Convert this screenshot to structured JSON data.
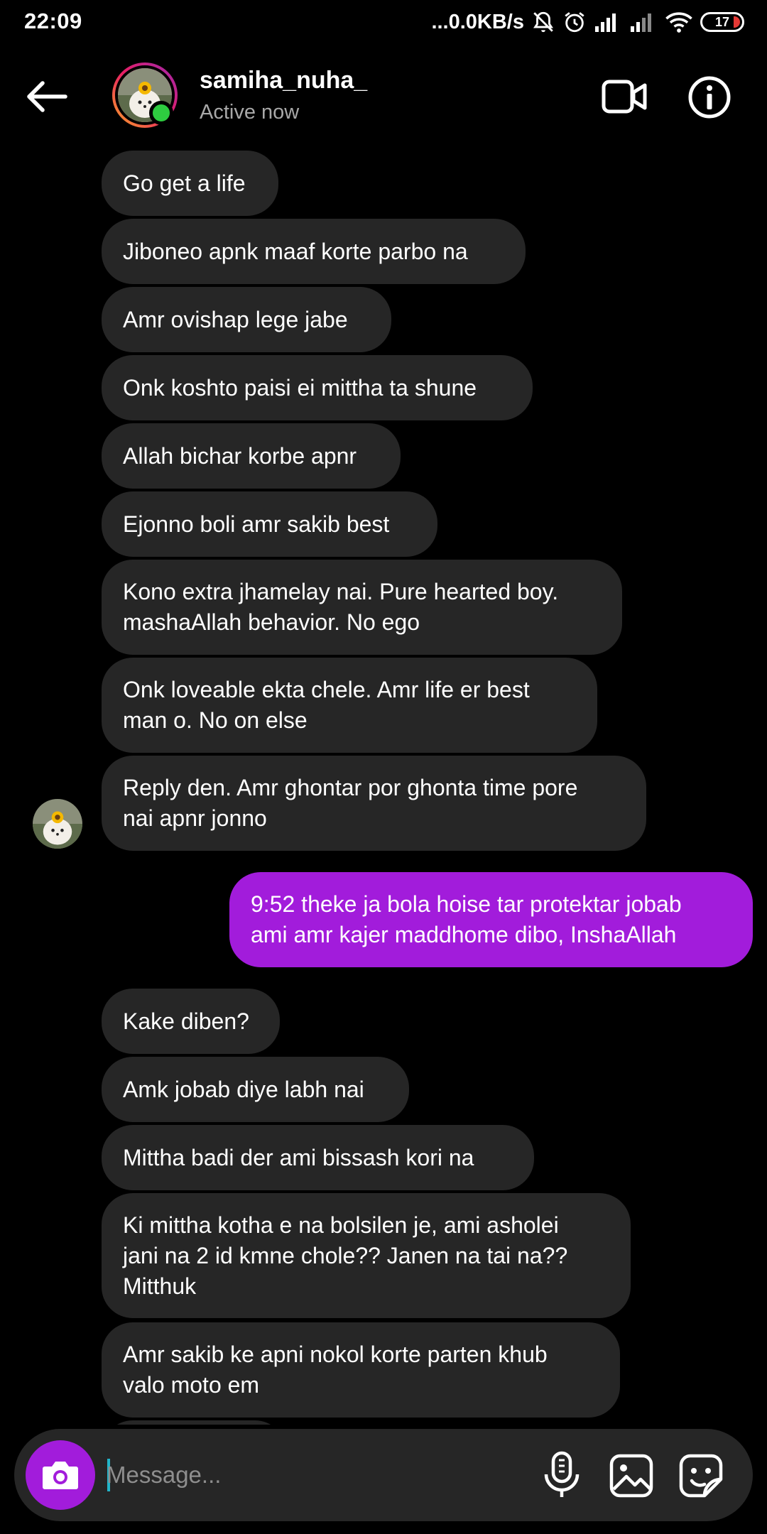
{
  "status_bar": {
    "time": "22:09",
    "net_speed": "...0.0KB/s",
    "battery": "17"
  },
  "header": {
    "name": "samiha_nuha_",
    "status": "Active now"
  },
  "messages": [
    {
      "lines": [
        "Go get a life"
      ]
    },
    {
      "lines": [
        "Jiboneo apnk maaf korte parbo na"
      ]
    },
    {
      "lines": [
        "Amr ovishap lege jabe"
      ]
    },
    {
      "lines": [
        "Onk koshto paisi ei mittha ta shune"
      ]
    },
    {
      "lines": [
        "Allah bichar korbe apnr"
      ]
    },
    {
      "lines": [
        "Ejonno boli amr sakib best"
      ]
    },
    {
      "lines": [
        "Kono extra jhamelay nai. Pure hearted boy.",
        "mashaAllah behavior.  No ego"
      ]
    },
    {
      "lines": [
        "Onk loveable ekta chele. Amr life er best",
        "man o. No on else"
      ]
    },
    {
      "lines": [
        "Reply den. Amr ghontar por ghonta time pore",
        "nai apnr jonno"
      ]
    },
    {
      "lines": [
        "9:52 theke ja bola hoise tar protektar jobab",
        "ami amr kajer maddhome dibo, InshaAllah"
      ]
    },
    {
      "lines": [
        "Kake diben?"
      ]
    },
    {
      "lines": [
        "Amk jobab diye labh nai"
      ]
    },
    {
      "lines": [
        "Mittha badi der ami bissash kori na"
      ]
    },
    {
      "lines": [
        "Ki mittha kotha e na bolsilen je, ami asholei",
        "jani na 2 id kmne chole?? Janen na tai na??",
        "Mitthuk"
      ]
    },
    {
      "lines": [
        "Amr sakib ke apni nokol korte parten khub",
        "valo moto em"
      ]
    }
  ],
  "composer": {
    "placeholder": "Message..."
  },
  "colors": {
    "incoming_bubble": "#262626",
    "outgoing_bubble": "#a21cdb",
    "online": "#2ecc40",
    "background": "#000000"
  }
}
